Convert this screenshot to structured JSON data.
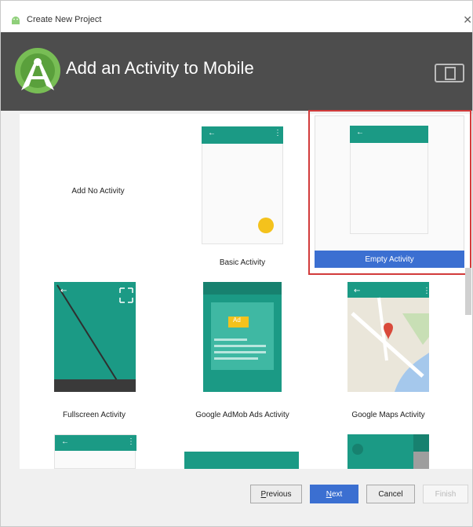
{
  "window": {
    "title": "Create New Project"
  },
  "header": {
    "title": "Add an Activity to Mobile"
  },
  "activities": [
    {
      "label": "Add No Activity"
    },
    {
      "label": "Basic Activity"
    },
    {
      "label": "Empty Activity",
      "selected": true
    },
    {
      "label": "Fullscreen Activity"
    },
    {
      "label": "Google AdMob Ads Activity"
    },
    {
      "label": "Google Maps Activity"
    }
  ],
  "admob": {
    "ad_label": "Ad"
  },
  "buttons": {
    "previous_first": "P",
    "previous_rest": "revious",
    "next_first": "N",
    "next_rest": "ext",
    "cancel": "Cancel",
    "finish": "Finish"
  },
  "colors": {
    "teal": "#1b9a85",
    "accent_blue": "#3b6fd1",
    "selection_red": "#d23b3b",
    "header_bg": "#4d4d4d",
    "fab_yellow": "#f4c21c"
  },
  "icons": [
    "android-icon",
    "android-studio-logo",
    "device-icon",
    "back-arrow-icon",
    "overflow-menu-icon",
    "fullscreen-icon",
    "map-pin-icon"
  ]
}
